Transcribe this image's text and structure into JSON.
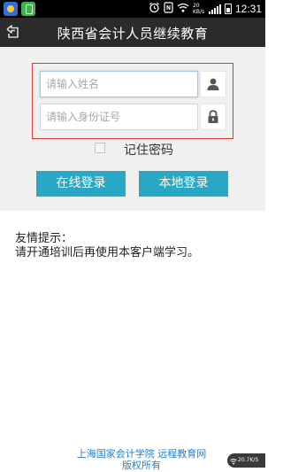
{
  "statusbar": {
    "time": "12:31",
    "data_label": "20 KB/s",
    "icons": [
      "app-icon",
      "app-icon",
      "alarm-icon",
      "nfc-icon",
      "wifi-icon",
      "signal-icon",
      "battery-icon"
    ]
  },
  "header": {
    "title": "陕西省会计人员继续教育",
    "back_icon": "back-icon"
  },
  "login": {
    "name_placeholder": "请输入姓名",
    "name_value": "",
    "id_placeholder": "请输入身份证号",
    "id_value": "",
    "user_icon": "user-icon",
    "lock_icon": "lock-icon",
    "remember_label": "记住密码",
    "remember_checked": false,
    "online_login_label": "在线登录",
    "local_login_label": "本地登录",
    "accent_color": "#29a8c6",
    "highlight_color": "#d9383a"
  },
  "tips": {
    "title": "友情提示：",
    "text": "请开通培训后再使用本客户端学习。"
  },
  "footer": {
    "line1": "上海国家会计学院 远程教育网",
    "line2": "版权所有"
  },
  "speed_widget": {
    "text": "20.7K/S"
  }
}
